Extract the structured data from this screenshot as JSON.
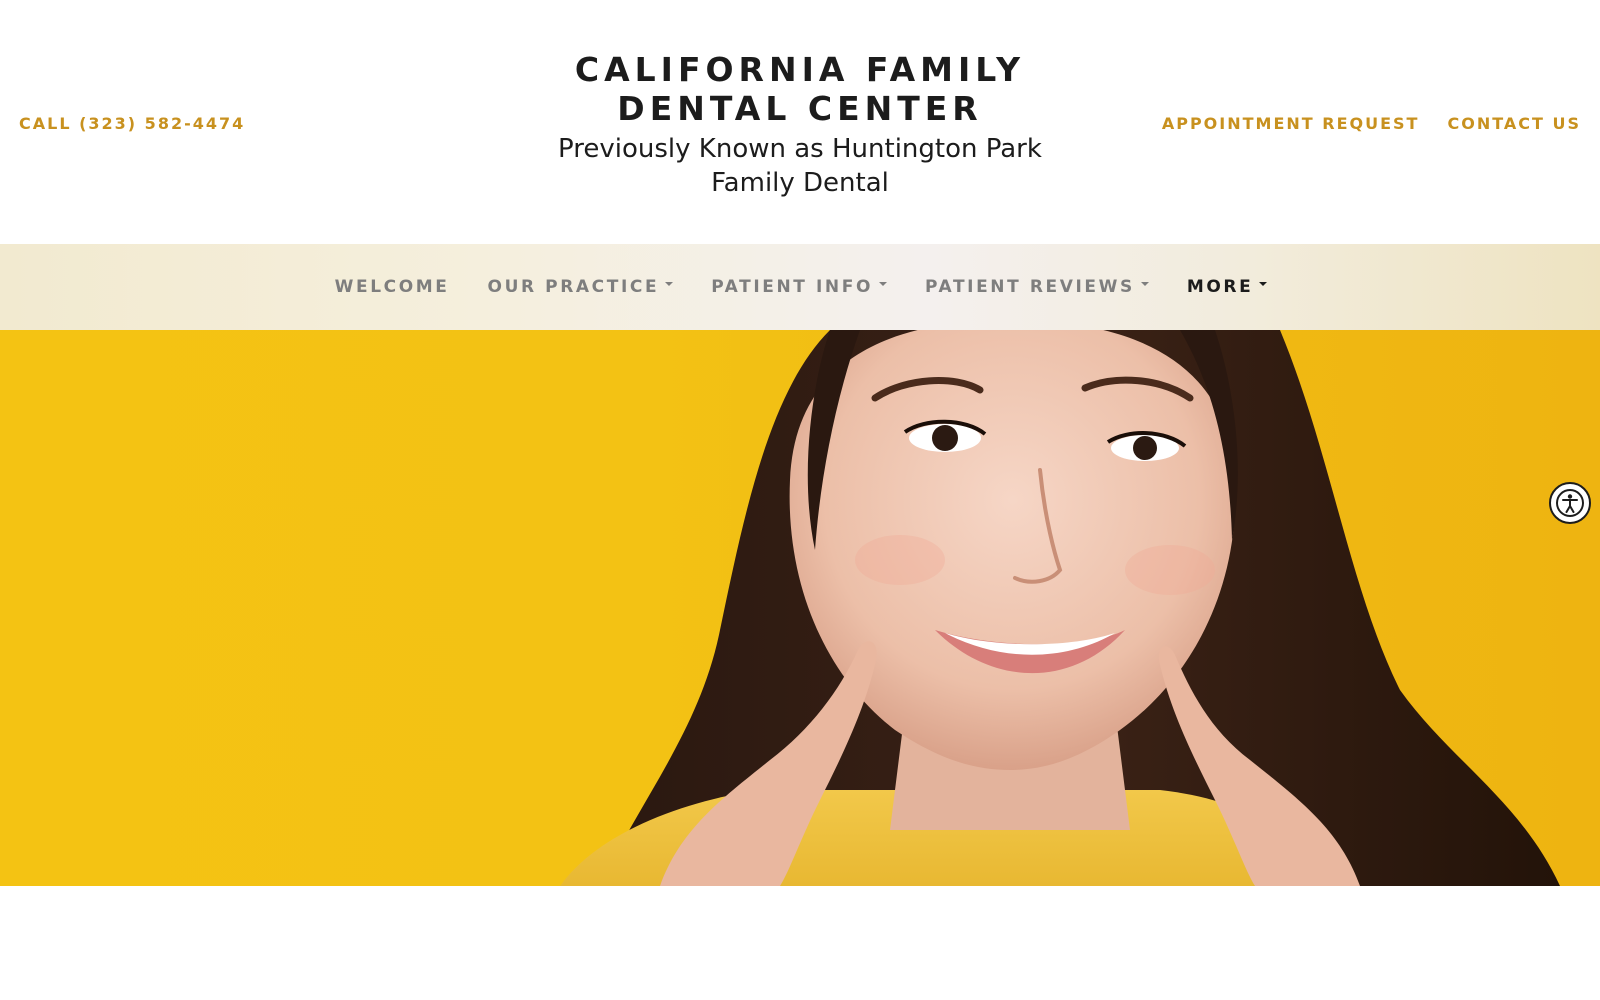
{
  "header": {
    "call_label": "CALL (323) 582-4474",
    "brand_title_line1": "CALIFORNIA FAMILY",
    "brand_title_line2": "DENTAL CENTER",
    "brand_subtitle": "Previously Known as Huntington Park Family Dental",
    "links": [
      {
        "label": "APPOINTMENT REQUEST"
      },
      {
        "label": "CONTACT US"
      }
    ]
  },
  "nav": {
    "items": [
      {
        "label": "WELCOME",
        "has_dropdown": false
      },
      {
        "label": "OUR PRACTICE",
        "has_dropdown": true
      },
      {
        "label": "PATIENT INFO",
        "has_dropdown": true
      },
      {
        "label": "PATIENT REVIEWS",
        "has_dropdown": true
      },
      {
        "label": "MORE",
        "has_dropdown": true,
        "active": true
      }
    ]
  },
  "hero": {
    "image_alt": "smiling woman pointing at her smile on yellow background",
    "background_color": "#f3c214"
  },
  "accessibility": {
    "icon": "accessibility-icon"
  },
  "colors": {
    "accent": "#c8911f",
    "text_dark": "#1c1c1c",
    "nav_text": "#7e7e7e"
  }
}
